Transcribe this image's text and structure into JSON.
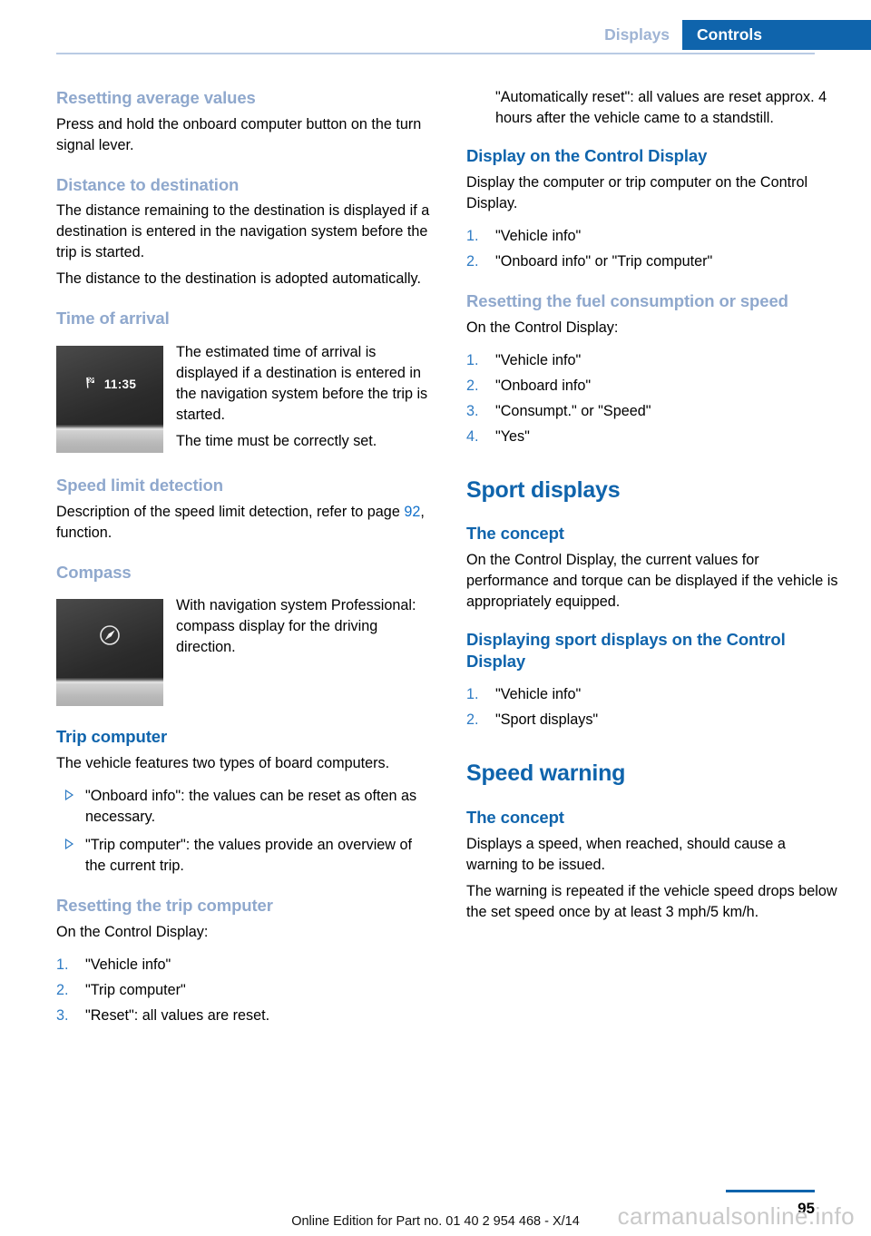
{
  "header": {
    "tab_inactive": "Displays",
    "tab_active": "Controls"
  },
  "colors": {
    "accent_blue": "#0F64AC",
    "subhead_blue": "#8FA8CD",
    "link_blue": "#1271CB",
    "list_number_blue": "#2E7BC4"
  },
  "left_column": {
    "resetting_average_values": {
      "heading": "Resetting average values",
      "body": "Press and hold the onboard computer button on the turn signal lever."
    },
    "distance_to_destination": {
      "heading": "Distance to destination",
      "body1": "The distance remaining to the destination is displayed if a destination is entered in the navigation system before the trip is started.",
      "body2": "The distance to the destination is adopted automatically."
    },
    "time_of_arrival": {
      "heading": "Time of arrival",
      "figure_icon": "checkered-flag-icon",
      "figure_time": "11:35",
      "body1": "The estimated time of arrival is displayed if a destination is entered in the navigation system before the trip is started.",
      "body2": "The time must be correctly set."
    },
    "speed_limit_detection": {
      "heading": "Speed limit detection",
      "body_before": "Description of the speed limit detection, refer to page ",
      "page_ref": "92",
      "body_after": ", function."
    },
    "compass": {
      "heading": "Compass",
      "figure_icon": "compass-icon",
      "body": "With navigation system Professional: compass display for the driving direction."
    },
    "trip_computer": {
      "heading": "Trip computer",
      "body": "The vehicle features two types of board computers.",
      "bullets": [
        "\"Onboard info\": the values can be reset as often as necessary.",
        "\"Trip computer\": the values provide an overview of the current trip."
      ]
    },
    "resetting_trip_computer": {
      "heading": "Resetting the trip computer",
      "body": "On the Control Display:",
      "steps": [
        {
          "num": "1.",
          "text": "\"Vehicle info\""
        },
        {
          "num": "2.",
          "text": "\"Trip computer\""
        },
        {
          "num": "3.",
          "text": "\"Reset\": all values are reset."
        }
      ]
    }
  },
  "right_column": {
    "continued_bullet": "\"Automatically reset\": all values are reset approx. 4 hours after the vehicle came to a standstill.",
    "display_on_control_display": {
      "heading": "Display on the Control Display",
      "body": "Display the computer or trip computer on the Control Display.",
      "steps": [
        {
          "num": "1.",
          "text": "\"Vehicle info\""
        },
        {
          "num": "2.",
          "text": "\"Onboard info\" or \"Trip computer\""
        }
      ]
    },
    "resetting_fuel_consumption": {
      "heading": "Resetting the fuel consumption or speed",
      "body": "On the Control Display:",
      "steps": [
        {
          "num": "1.",
          "text": "\"Vehicle info\""
        },
        {
          "num": "2.",
          "text": "\"Onboard info\""
        },
        {
          "num": "3.",
          "text": "\"Consumpt.\" or \"Speed\""
        },
        {
          "num": "4.",
          "text": "\"Yes\""
        }
      ]
    },
    "sport_displays": {
      "heading": "Sport displays",
      "concept_heading": "The concept",
      "concept_body": "On the Control Display, the current values for performance and torque can be displayed if the vehicle is appropriately equipped.",
      "displaying_heading": "Displaying sport displays on the Control Display",
      "steps": [
        {
          "num": "1.",
          "text": "\"Vehicle info\""
        },
        {
          "num": "2.",
          "text": "\"Sport displays\""
        }
      ]
    },
    "speed_warning": {
      "heading": "Speed warning",
      "concept_heading": "The concept",
      "body1": "Displays a speed, when reached, should cause a warning to be issued.",
      "body2": "The warning is repeated if the vehicle speed drops below the set speed once by at least 3 mph/5 km/h."
    }
  },
  "footer": {
    "edition": "Online Edition for Part no. 01 40 2 954 468 - X/14",
    "page_number": "95",
    "watermark": "carmanualsonline.info"
  }
}
